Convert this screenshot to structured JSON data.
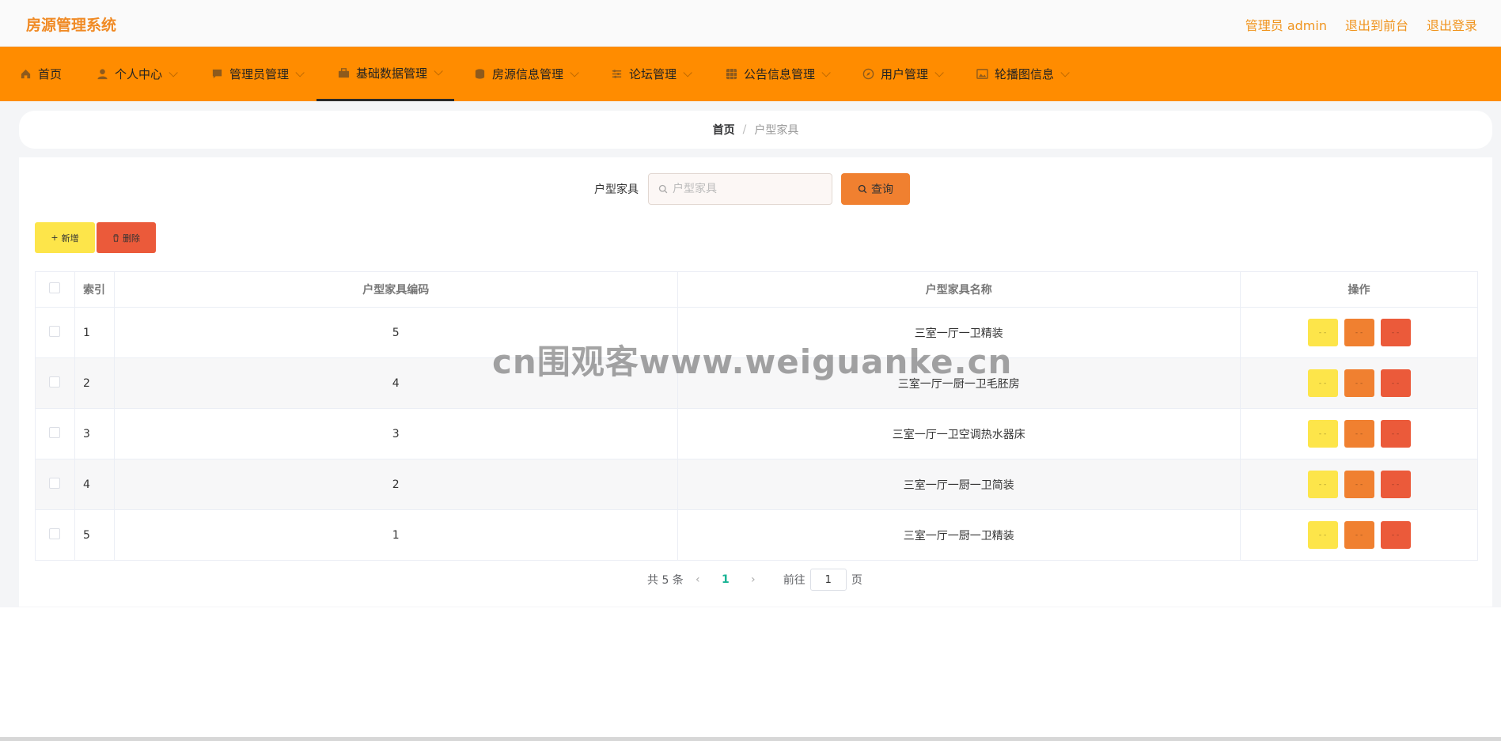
{
  "header": {
    "brand": "房源管理系统",
    "admin_label": "管理员 admin",
    "front_link": "退出到前台",
    "logout_link": "退出登录"
  },
  "nav": {
    "items": [
      {
        "label": "首页",
        "icon": "home-icon"
      },
      {
        "label": "个人中心",
        "icon": "user-icon"
      },
      {
        "label": "管理员管理",
        "icon": "chat-icon"
      },
      {
        "label": "基础数据管理",
        "icon": "briefcase-icon"
      },
      {
        "label": "房源信息管理",
        "icon": "coin-icon"
      },
      {
        "label": "论坛管理",
        "icon": "sliders-icon"
      },
      {
        "label": "公告信息管理",
        "icon": "grid-icon"
      },
      {
        "label": "用户管理",
        "icon": "compass-icon"
      },
      {
        "label": "轮播图信息",
        "icon": "picture-icon"
      }
    ],
    "active_index": 3
  },
  "breadcrumb": {
    "home": "首页",
    "separator": "/",
    "current": "户型家具"
  },
  "search": {
    "label": "户型家具",
    "placeholder": "户型家具",
    "value": "",
    "button_label": "查询"
  },
  "actions": {
    "add_label": "新增",
    "delete_label": "删除"
  },
  "table": {
    "headers": {
      "index": "索引",
      "code": "户型家具编码",
      "name": "户型家具名称",
      "ops": "操作"
    },
    "rows": [
      {
        "index": "1",
        "code": "5",
        "name": "三室一厅一卫精装"
      },
      {
        "index": "2",
        "code": "4",
        "name": "三室一厅一厨一卫毛胚房"
      },
      {
        "index": "3",
        "code": "3",
        "name": "三室一厅一卫空调热水器床"
      },
      {
        "index": "4",
        "code": "2",
        "name": "三室一厅一厨一卫简装"
      },
      {
        "index": "5",
        "code": "1",
        "name": "三室一厅一厨一卫精装"
      }
    ],
    "op_button_text": "- -"
  },
  "pagination": {
    "total_text": "共 5 条",
    "prev": "‹",
    "current_page": "1",
    "next": "›",
    "goto_label": "前往",
    "goto_value": "1",
    "page_suffix": "页"
  },
  "watermark": "cn围观客www.weiguanke.cn",
  "colors": {
    "accent": "#ff8c00",
    "brand_text": "#f08a24",
    "add_button": "#fde54a",
    "delete_button": "#eb5a3a",
    "search_button": "#f08030",
    "active_page": "#19b394"
  }
}
